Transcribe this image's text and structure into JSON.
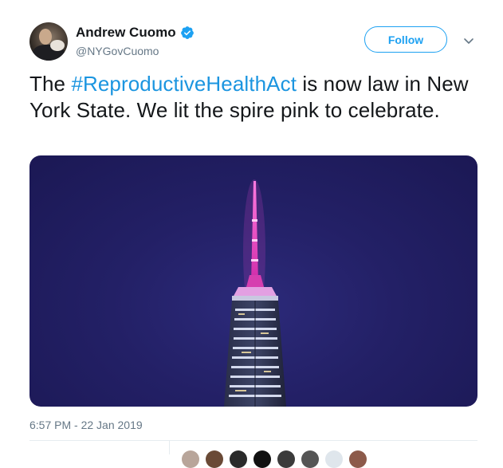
{
  "author": {
    "name": "Andrew Cuomo",
    "handle": "@NYGovCuomo",
    "verified": true
  },
  "actions": {
    "follow_label": "Follow"
  },
  "tweet": {
    "text_before": "The ",
    "hashtag": "#ReproductiveHealthAct",
    "text_after": " is now law in New York State. We lit the spire pink to celebrate."
  },
  "media": {
    "description_icon": "photo-spire-pink"
  },
  "meta": {
    "timestamp": "6:57 PM - 22 Jan 2019"
  },
  "colors": {
    "accent": "#1da1f2",
    "hashtag": "#1b95e0",
    "secondary_text": "#657786",
    "spire_pink": "#e040c0",
    "night_sky": "#232066"
  },
  "icons": [
    "verified-badge-icon",
    "chevron-down-icon"
  ]
}
